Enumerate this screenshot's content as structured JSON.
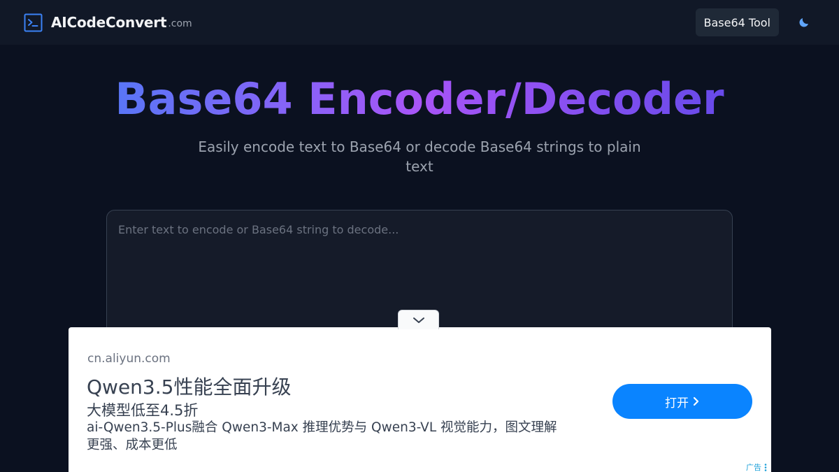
{
  "header": {
    "brand_name": "AICodeConvert",
    "brand_tld": ".com",
    "nav_link_label": "Base64 Tool",
    "brand_icon": "terminal-icon",
    "theme_icon": "moon-icon"
  },
  "hero": {
    "title": "Base64 Encoder/Decoder",
    "subtitle": "Easily encode text to Base64 or decode Base64 strings to plain text"
  },
  "editor": {
    "placeholder": "Enter text to encode or Base64 string to decode...",
    "value": ""
  },
  "ad": {
    "domain": "cn.aliyun.com",
    "headline": "Qwen3.5性能全面升级",
    "subheadline": "大模型低至4.5折",
    "description": "ai-Qwen3.5-Plus融合 Qwen3-Max 推理优势与 Qwen3-VL 视觉能力，图文理解更强、成本更低",
    "cta_label": "打开",
    "badge_label": "广告",
    "collapse_icon": "chevron-down-icon"
  },
  "colors": {
    "page_bg": "#0b1120",
    "nav_bg": "#111827",
    "accent_blue": "#3b82f6",
    "accent_purple": "#a855f7",
    "cta_blue": "#0a84ff"
  }
}
